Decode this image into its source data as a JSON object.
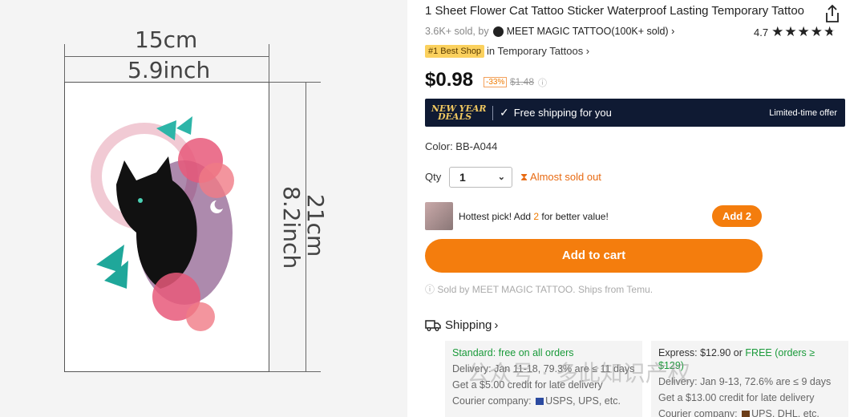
{
  "image_panel": {
    "width_cm": "15cm",
    "width_in": "5.9inch",
    "height_cm": "21cm",
    "height_in": "8.2inch"
  },
  "product": {
    "title": "1 Sheet Flower Cat Tattoo Sticker Waterproof Lasting Temporary Tattoo",
    "sold_prefix": "3.6K+ sold, by",
    "shop_name": "MEET MAGIC TATTOO(100K+ sold)",
    "shop_chevron": "›",
    "rating_value": "4.7",
    "rating_stars": 4.7,
    "best_badge": "#1 Best Shop",
    "best_category": "in Temporary Tattoos ›",
    "price": "$0.98",
    "discount": "-33%",
    "original_price": "$1.48",
    "info_icon": "info-icon"
  },
  "shipping_bar": {
    "promo_line1": "NEW YEAR",
    "promo_line2": "DEALS",
    "free_shipping": "Free shipping for you",
    "limited": "Limited-time offer",
    "bg_color": "#0f1a33"
  },
  "options": {
    "color_label": "Color: BB-A044",
    "qty_label": "Qty",
    "qty_value": "1",
    "stock_status": "Almost sold out"
  },
  "upsell": {
    "text_before": "Hottest pick! Add ",
    "count": "2",
    "text_after": " for better value!",
    "button": "Add 2"
  },
  "cart": {
    "button": "Add to cart",
    "accent": "#f47d0d",
    "sold_by": "Sold by MEET MAGIC TATTOO. Ships from Temu."
  },
  "shipping": {
    "heading": "Shipping",
    "chevron": "›",
    "standard": {
      "title": "Standard: free on all orders",
      "delivery": "Delivery: Jan 11-18, 79.3% are ≤ 11 days",
      "credit": "Get a $5.00 credit for late delivery",
      "courier_label": "Courier company:",
      "couriers": "USPS, UPS, etc."
    },
    "express": {
      "title_prefix": "Express: $12.90 or ",
      "title_free": "FREE (orders ≥ $129)",
      "delivery": "Delivery: Jan 9-13, 72.6% are ≤ 9 days",
      "credit": "Get a $13.00 credit for late delivery",
      "courier_label": "Courier company:",
      "couriers": "UPS, DHL, etc."
    }
  },
  "watermark": "公众号 · 多此知识产权"
}
